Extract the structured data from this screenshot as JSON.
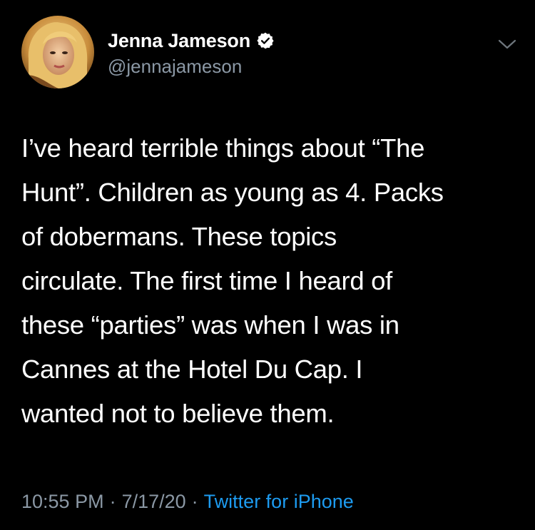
{
  "tweet": {
    "author": {
      "display_name": "Jenna Jameson",
      "handle": "@jennajameson",
      "verified_icon": "verified-badge-icon",
      "avatar_icon": "profile-photo"
    },
    "more_icon": "chevron-down-icon",
    "text_lines": [
      "I’ve heard terrible things about “The",
      "Hunt”. Children as young as 4. Packs",
      "of dobermans. These topics",
      "circulate. The first time I heard of",
      "these “parties” was when I was in",
      "Cannes at the Hotel Du Cap. I",
      "wanted not to believe them."
    ],
    "meta": {
      "time": "10:55 PM",
      "separator": "·",
      "date": "7/17/20",
      "source": "Twitter for iPhone"
    }
  },
  "colors": {
    "background": "#000000",
    "text": "#ffffff",
    "secondary_text": "#8b98a5",
    "link": "#1d9bf0"
  }
}
